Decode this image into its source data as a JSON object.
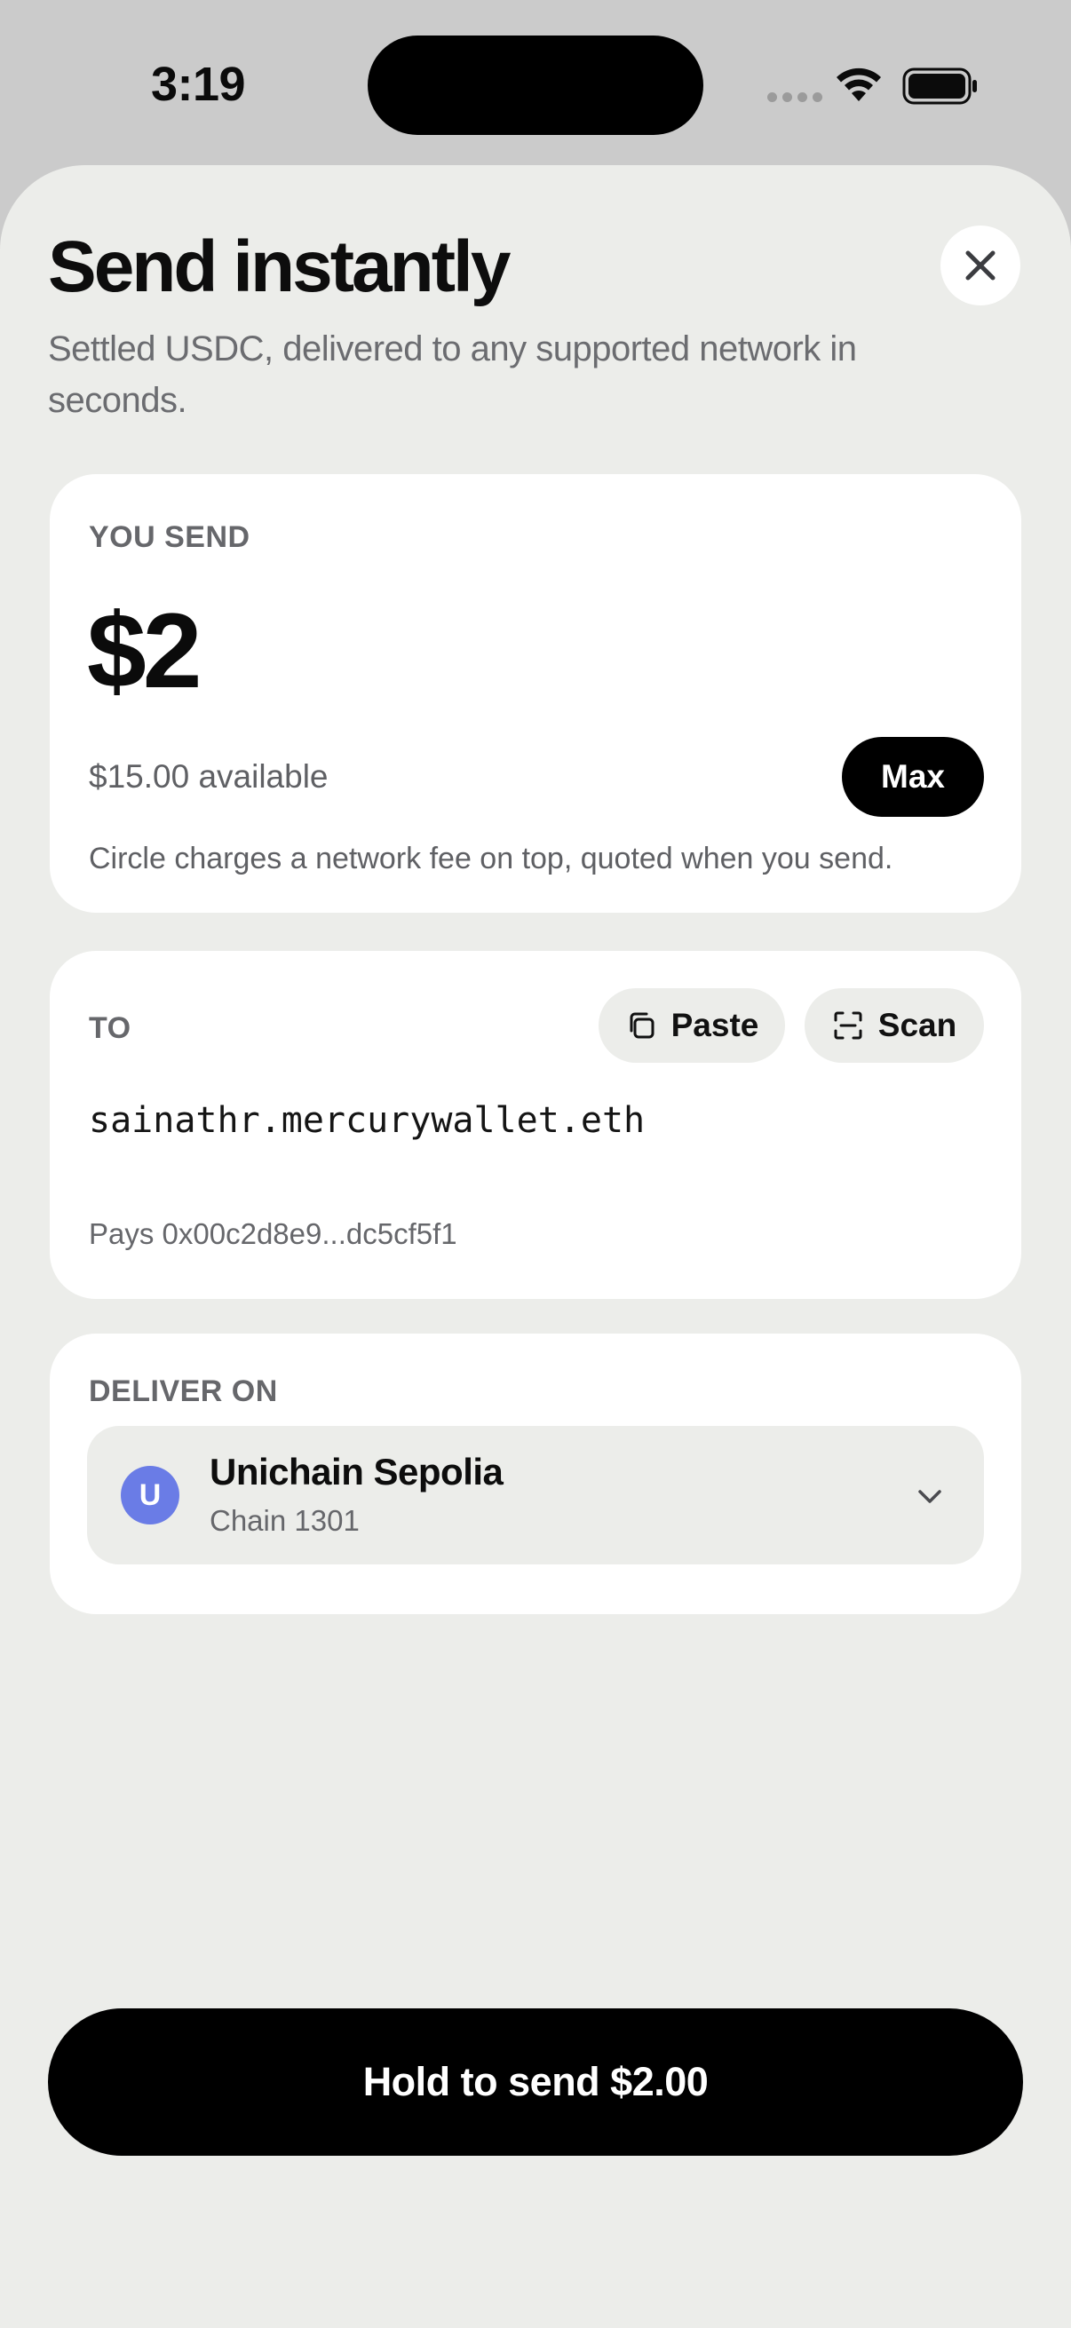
{
  "status_bar": {
    "time": "3:19"
  },
  "header": {
    "title": "Send instantly",
    "subtitle": "Settled USDC, delivered to any supported network in seconds.",
    "close_icon": "close-icon"
  },
  "send_card": {
    "label": "YOU SEND",
    "amount": "$2",
    "available": "$15.00 available",
    "max_label": "Max",
    "fee_note": "Circle charges a network fee on top, quoted when you send."
  },
  "to_card": {
    "label": "TO",
    "paste_label": "Paste",
    "scan_label": "Scan",
    "recipient": "sainathr.mercurywallet.eth",
    "resolved": "Pays 0x00c2d8e9...dc5cf5f1"
  },
  "deliver_card": {
    "label": "DELIVER ON",
    "network_initial": "U",
    "network_name": "Unichain Sepolia",
    "network_chain": "Chain 1301",
    "badge_color": "#6a7ce6"
  },
  "footer": {
    "hold_label": "Hold to send $2.00"
  },
  "colors": {
    "background": "#ecedea",
    "card": "#ffffff",
    "primary": "#000000",
    "muted_text": "#66676b"
  }
}
